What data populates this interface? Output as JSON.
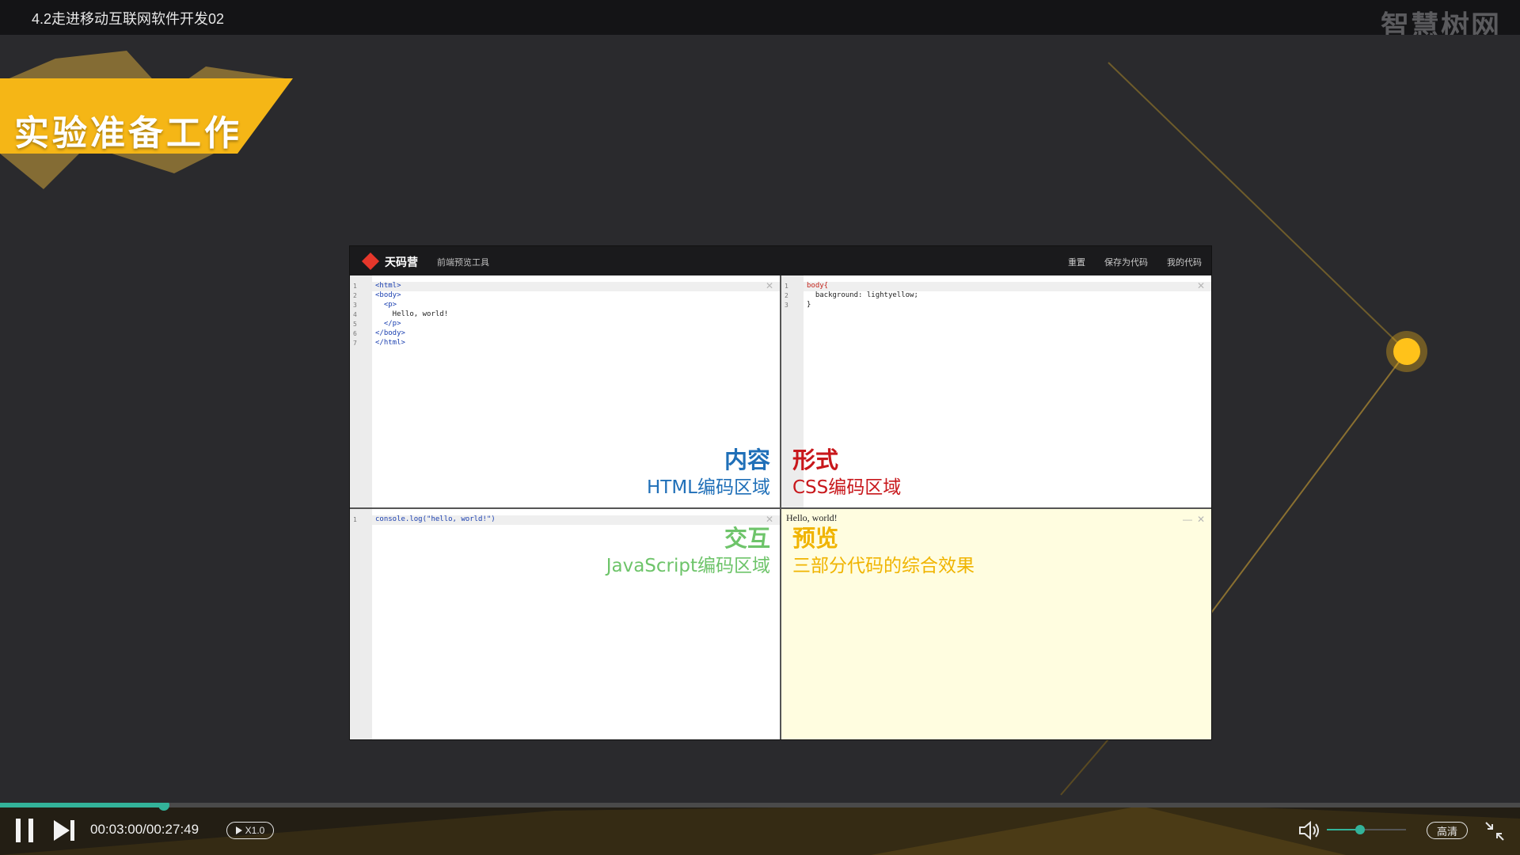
{
  "window": {
    "title": "4.2走进移动互联网软件开发02",
    "brand": "智慧树网"
  },
  "slide": {
    "banner": "实验准备工作",
    "editor": {
      "logo_text": "天码营",
      "subtitle": "前端预览工具",
      "nav": [
        "重置",
        "保存为代码",
        "我的代码"
      ],
      "panes": {
        "html": {
          "code_lines": [
            "<html>",
            "<body>",
            "  <p>",
            "    Hello, world!",
            "  </p>",
            "</body>",
            "</html>"
          ],
          "label_big": "内容",
          "label_small": "HTML编码区域",
          "color": "#1f6fb8"
        },
        "css": {
          "code_lines": [
            "body{",
            "  background: lightyellow;",
            "}"
          ],
          "label_big": "形式",
          "label_small": "CSS编码区域",
          "color": "#c8171b"
        },
        "js": {
          "code_lines": [
            "console.log(\"hello, world!\")"
          ],
          "label_big": "交互",
          "label_small": "JavaScript编码区域",
          "color": "#6ec46a"
        },
        "preview": {
          "output_text": "Hello, world!",
          "label_big": "预览",
          "label_small": "三部分代码的综合效果",
          "color": "#f0b400"
        }
      }
    }
  },
  "player": {
    "current_time": "00:03:00",
    "total_time": "00:27:49",
    "time_display": "00:03:00/00:27:49",
    "progress": 0.108,
    "speed": "X1.0",
    "volume": 0.42,
    "quality": "高清",
    "accent": "#33b39a"
  }
}
